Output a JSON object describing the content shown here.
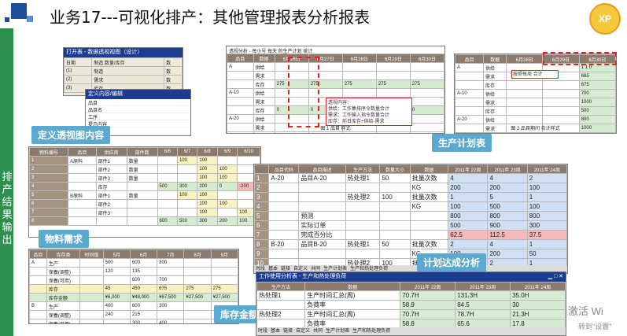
{
  "header": {
    "title": "业务17---可视化排产：其他管理报表分析报表",
    "logo_text": "XP"
  },
  "sidebar": {
    "label": "排产结果输出"
  },
  "callouts": {
    "pivot": "定义透视图内容",
    "plan": "生产计划表",
    "material": "物料需求",
    "achieve": "计划达成分析",
    "inventory": "库存金额分析"
  },
  "pivot_shot": {
    "title": "打开表 - 数据透视视图（设计）",
    "rows": [
      {
        "col1": "日期",
        "col2": "制造.数量/库存",
        "col3": "数"
      },
      {
        "col1": "(1)",
        "col2": "制造",
        "col3": "数"
      },
      {
        "col1": "(2)",
        "col2": "需求",
        "col3": "数"
      },
      {
        "col1": "(3)",
        "col2": "库存",
        "col3": "数"
      }
    ],
    "dialog_title": "定义内容/编辑",
    "dialog_items": [
      "品目",
      "品目名",
      "工序",
      "提示内容",
      "日期"
    ]
  },
  "plan_shot": {
    "title": "透视分析 - 每小号 每天 的生产计划 统计",
    "headers": [
      "品目",
      "数据",
      "6月26日",
      "6月27日",
      "6月28日",
      "6月29日",
      "6月30日"
    ],
    "rows": [
      {
        "item": "A",
        "kind": "供给",
        "v": [
          "",
          "",
          "",
          "",
          ""
        ]
      },
      {
        "item": "",
        "kind": "需求",
        "v": [
          "",
          "",
          "",
          "",
          ""
        ]
      },
      {
        "item": "",
        "kind": "库存",
        "v": [
          "275",
          "275",
          "275",
          "275",
          "275"
        ]
      },
      {
        "item": "A-10",
        "kind": "供给",
        "v": [
          "",
          "",
          "",
          "",
          ""
        ]
      },
      {
        "item": "",
        "kind": "需求",
        "v": [
          "",
          "",
          "",
          "",
          ""
        ]
      },
      {
        "item": "",
        "kind": "库存",
        "v": [
          "0",
          "0",
          "0",
          "0",
          "0"
        ]
      },
      {
        "item": "A-20",
        "kind": "供给",
        "v": [
          "",
          "",
          "",
          "",
          ""
        ]
      },
      {
        "item": "",
        "kind": "需求",
        "v": [
          "",
          "",
          "",
          "",
          ""
        ]
      },
      {
        "item": "",
        "kind": "库存",
        "v": [
          "",
          "",
          "",
          "",
          ""
        ]
      },
      {
        "item": "A原料",
        "kind": "供给",
        "v": [
          "",
          "",
          "",
          "",
          ""
        ]
      },
      {
        "item": "",
        "kind": "需求",
        "v": [
          "",
          "",
          "",
          "",
          ""
        ]
      },
      {
        "item": "",
        "kind": "库存",
        "v": [
          "-1200",
          "-1200",
          "-1200",
          "-1200",
          "-1200"
        ]
      }
    ],
    "note_lines": [
      "透视内容：",
      "供给：工作集排序令数量合计",
      "需求：工作输入指令数量合计",
      "库存：前日库存+供给-需求"
    ],
    "fig_caption": "图 1 品目 样式",
    "side_note": "通透，提示每天的生产计划",
    "right_headers": [
      "品目",
      "数据",
      "6月28日",
      "6月29日",
      "6月30日"
    ],
    "right_rows": [
      {
        "item": "A",
        "kind": "供给",
        "v": [
          "",
          "",
          "1 1 0"
        ]
      },
      {
        "item": "",
        "kind": "需求",
        "v": [
          "",
          "",
          "665"
        ]
      },
      {
        "item": "",
        "kind": "库存",
        "v": [
          "",
          "",
          "675"
        ]
      },
      {
        "item": "A-10",
        "kind": "供给",
        "v": [
          "",
          "",
          "700"
        ]
      },
      {
        "item": "",
        "kind": "需求",
        "v": [
          "",
          "",
          "1000"
        ]
      },
      {
        "item": "",
        "kind": "库存",
        "v": [
          "",
          "",
          "500"
        ]
      },
      {
        "item": "A-20",
        "kind": "供给",
        "v": [
          "",
          "",
          "800"
        ]
      },
      {
        "item": "",
        "kind": "需求",
        "v": [
          "",
          "",
          "1000"
        ]
      },
      {
        "item": "",
        "kind": "库存",
        "v": [
          "",
          "",
          "800"
        ]
      },
      {
        "item": "A原料",
        "kind": "需求",
        "v": [
          "",
          "",
          "500"
        ]
      },
      {
        "item": "",
        "kind": "库存",
        "v": [
          "",
          "",
          "-1200"
        ]
      }
    ],
    "right_note": "按照每周 合计",
    "right_caption": "图 2 品目期间 合计样式"
  },
  "material_shot": {
    "headers": [
      "物料编号",
      "品目",
      "供应商",
      "部件数",
      "6/6",
      "6/7",
      "6/8",
      "6/9",
      "6/10"
    ],
    "rows": [
      {
        "n": "1",
        "mat": "A原料",
        "part": "部件1",
        "kind": "数量",
        "v": [
          "",
          "100",
          "100",
          "",
          ""
        ]
      },
      {
        "n": "2",
        "mat": "",
        "part": "部件2",
        "kind": "数量",
        "v": [
          "",
          "",
          "100",
          "100",
          ""
        ]
      },
      {
        "n": "3",
        "mat": "",
        "part": "部件3",
        "kind": "数量",
        "v": [
          "",
          "",
          "100",
          "100",
          ""
        ]
      },
      {
        "n": "4",
        "mat": "",
        "part": "库存",
        "kind": "",
        "v": [
          "500",
          "300",
          "200",
          "0",
          "-200"
        ]
      },
      {
        "n": "5",
        "mat": "B原料",
        "part": "部件1",
        "kind": "数量",
        "v": [
          "",
          "100",
          "100",
          "",
          ""
        ]
      },
      {
        "n": "6",
        "mat": "",
        "part": "部件2",
        "kind": "",
        "v": [
          "",
          "",
          "100",
          "100",
          ""
        ]
      },
      {
        "n": "7",
        "mat": "",
        "part": "部件3",
        "kind": "",
        "v": [
          "",
          "",
          "100",
          "",
          "100"
        ]
      },
      {
        "n": "8",
        "mat": "",
        "part": "",
        "kind": "",
        "v": [
          "600",
          "500",
          "300",
          "200",
          "100"
        ]
      }
    ]
  },
  "inventory_shot": {
    "headers": [
      "品目",
      "库存类",
      "时间值",
      "5月",
      "6月",
      "7月",
      "8月",
      "9月"
    ],
    "rows": [
      {
        "item": "A",
        "kind": "生产",
        "v": [
          "500",
          "600",
          "300",
          "",
          ""
        ]
      },
      {
        "item": "",
        "kind": "保養(调整)",
        "v": [
          "120",
          "135",
          "",
          "",
          ""
        ]
      },
      {
        "item": "",
        "kind": "保養(可用)",
        "v": [
          "",
          "600",
          "700",
          "",
          ""
        ]
      },
      {
        "item": "",
        "kind": "库存",
        "v": [
          "45",
          "450",
          "675",
          "275",
          "275"
        ]
      },
      {
        "item": "",
        "kind": "库存金额",
        "v": [
          "¥6,000",
          "¥48,000",
          "¥67,500",
          "¥27,500",
          "¥27,500"
        ]
      },
      {
        "item": "B",
        "kind": "生产",
        "v": [
          "400",
          "600",
          "300",
          "",
          ""
        ]
      },
      {
        "item": "",
        "kind": "保養(调整)",
        "v": [
          "240",
          "215",
          "",
          "",
          ""
        ]
      },
      {
        "item": "",
        "kind": "保養(可用)",
        "v": [
          "",
          "300",
          "400",
          "",
          ""
        ]
      },
      {
        "item": "",
        "kind": "库存",
        "v": [
          "160",
          "215",
          "55",
          "55",
          "55"
        ]
      },
      {
        "item": "",
        "kind": "库存金额",
        "v": [
          "¥12,000",
          "¥21,200",
          "¥37,600",
          "¥6,600",
          "¥6,600"
        ]
      }
    ]
  },
  "achieve_shot": {
    "headers": [
      "",
      "品目代码",
      "品目描述",
      "生产方法",
      "数量大小",
      "数据",
      "2011年 22周",
      "2011年 23周",
      "2011年 24周"
    ],
    "rows": [
      {
        "n": "1",
        "code": "A-20",
        "desc": "品目A-20",
        "method": "热处理1",
        "qty": "50",
        "kind": "批量次数",
        "v": [
          "4",
          "4",
          "2"
        ]
      },
      {
        "n": "2",
        "code": "",
        "desc": "",
        "method": "",
        "qty": "",
        "kind": "KG",
        "v": [
          "200",
          "200",
          "100"
        ]
      },
      {
        "n": "3",
        "code": "",
        "desc": "",
        "method": "热处理2",
        "qty": "100",
        "kind": "批量次数",
        "v": [
          "1",
          "5",
          "1"
        ]
      },
      {
        "n": "4",
        "code": "",
        "desc": "",
        "method": "",
        "qty": "",
        "kind": "KG",
        "v": [
          "100",
          "500",
          "100"
        ]
      },
      {
        "n": "5",
        "code": "",
        "desc": "预测",
        "method": "",
        "qty": "",
        "kind": "",
        "v": [
          "800",
          "800",
          "800"
        ]
      },
      {
        "n": "6",
        "code": "",
        "desc": "实际订单",
        "method": "",
        "qty": "",
        "kind": "",
        "v": [
          "500",
          "900",
          "300"
        ]
      },
      {
        "n": "7",
        "code": "",
        "desc": "完成百分比",
        "method": "",
        "qty": "",
        "kind": "",
        "v": [
          "62.5",
          "112.5",
          "37.5"
        ]
      },
      {
        "n": "8",
        "code": "B-20",
        "desc": "品目B-20",
        "method": "热处理1",
        "qty": "50",
        "kind": "批量次数",
        "v": [
          "2",
          "4",
          "1"
        ]
      },
      {
        "n": "9",
        "code": "",
        "desc": "",
        "method": "",
        "qty": "",
        "kind": "KG",
        "v": [
          "100",
          "200",
          "50"
        ]
      },
      {
        "n": "10",
        "code": "",
        "desc": "",
        "method": "热处理2",
        "qty": "100",
        "kind": "批量次数",
        "v": [
          "2",
          "2",
          "1"
        ]
      }
    ],
    "tabs": [
      "时段",
      "基本",
      "链接",
      "自定义",
      "共同",
      "生产计划表",
      "生产和热处理负荷"
    ]
  },
  "load_shot": {
    "title": "工作使用分析表 - 生产和热处理负荷",
    "headers": [
      "生产方法",
      "数据",
      "2011年 22周",
      "2011年 23周",
      "2011年 24周"
    ],
    "rows": [
      {
        "method": "热处理1",
        "kind": "生产时间汇总(周)",
        "v": [
          "70.7H",
          "131.3H",
          "35.0H"
        ]
      },
      {
        "method": "",
        "kind": "负荷率",
        "v": [
          "58.9",
          "84.5",
          "30"
        ]
      },
      {
        "method": "热处理2",
        "kind": "生产时间汇总(周)",
        "v": [
          "70.7H",
          "78.7H",
          "21.3H"
        ]
      },
      {
        "method": "",
        "kind": "负荷率",
        "v": [
          "58.8",
          "65.6",
          "17.8"
        ]
      }
    ],
    "tabs": [
      "时段",
      "基本",
      "链接",
      "自定义",
      "共同",
      "生产计划表",
      "生产和热处理负荷"
    ]
  },
  "watermark": {
    "line1": "激活 Wi",
    "line2": "转到\"设置\""
  }
}
